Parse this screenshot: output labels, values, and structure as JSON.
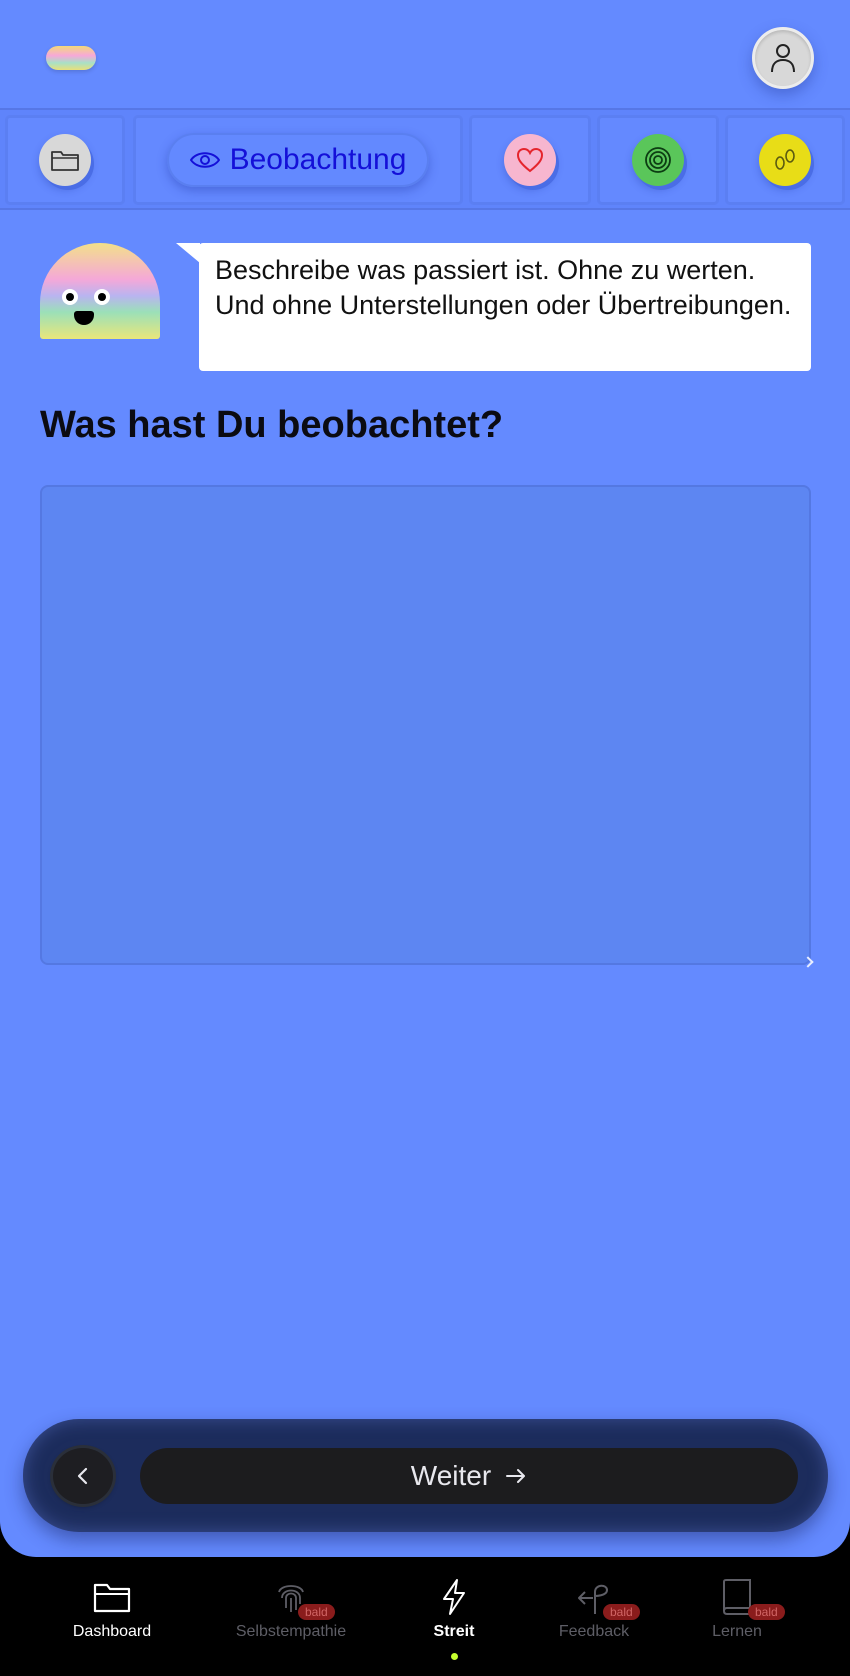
{
  "header": {
    "logo_icon": "rainbow-pill-logo",
    "profile_icon": "user-icon"
  },
  "steps": [
    {
      "icon": "folder-icon",
      "color": "#d8d8d8"
    },
    {
      "icon": "eye-icon",
      "label": "Beobachtung",
      "active": true
    },
    {
      "icon": "heart-icon",
      "color": "#f7b6cf"
    },
    {
      "icon": "spiral-icon",
      "color": "#5ac65a"
    },
    {
      "icon": "footsteps-icon",
      "color": "#e8dd17"
    }
  ],
  "hint": {
    "text": "Beschreibe was passiert ist. Ohne zu werten. Und ohne Unterstellungen oder Übertreibungen."
  },
  "question": "Was hast Du beobachtet?",
  "answer": {
    "value": "",
    "placeholder": ""
  },
  "actions": {
    "back_icon": "chevron-left-icon",
    "next_label": "Weiter",
    "next_icon": "arrow-right-icon"
  },
  "tabbar": {
    "items": [
      {
        "label": "Dashboard",
        "icon": "folder-icon",
        "badge": ""
      },
      {
        "label": "Selbstempathie",
        "icon": "fingerprint-icon",
        "badge": "bald"
      },
      {
        "label": "Streit",
        "icon": "lightning-icon",
        "badge": "",
        "active": true
      },
      {
        "label": "Feedback",
        "icon": "signpost-icon",
        "badge": "bald"
      },
      {
        "label": "Lernen",
        "icon": "book-icon",
        "badge": "bald"
      }
    ],
    "active_color": "#c6ff2e"
  }
}
